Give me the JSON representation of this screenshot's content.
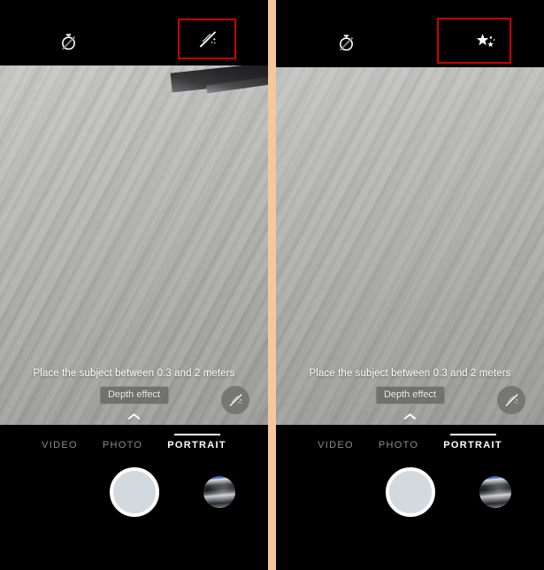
{
  "comparison": {
    "divider_color": "#f6c79d",
    "annotation_color": "#cc0000"
  },
  "panels": [
    {
      "id": "left",
      "topbar": {
        "timer": {
          "icon": "timer-off-icon",
          "label": "Timer off"
        },
        "magic": {
          "icon": "magic-wand-off-icon",
          "label": "Beauty effect off",
          "highlighted": true
        }
      },
      "viewfinder": {
        "hint": "Place the subject between 0.3 and 2 meters",
        "depth_effect_label": "Depth effect",
        "magic_toggle": {
          "icon": "magic-wand-off-icon",
          "label": "Beauty effect off"
        },
        "expand": {
          "icon": "chevron-up-icon",
          "label": "More settings"
        }
      },
      "modes": [
        {
          "label": "VIDEO",
          "active": false
        },
        {
          "label": "PHOTO",
          "active": false
        },
        {
          "label": "PORTRAIT",
          "active": true
        }
      ],
      "shutter": {
        "label": "Shutter",
        "fill_color": "#d2dae0",
        "ring_color": "#ffffff"
      },
      "gallery": {
        "label": "Gallery thumbnail"
      }
    },
    {
      "id": "right",
      "topbar": {
        "timer": {
          "icon": "timer-off-icon",
          "label": "Timer off"
        },
        "magic": {
          "icon": "sparkle-stars-icon",
          "label": "Beauty effect on",
          "highlighted": true
        }
      },
      "viewfinder": {
        "hint": "Place the subject between 0.3 and 2 meters",
        "depth_effect_label": "Depth effect",
        "magic_toggle": {
          "icon": "magic-wand-off-icon",
          "label": "Beauty effect off"
        },
        "expand": {
          "icon": "chevron-up-icon",
          "label": "More settings"
        }
      },
      "modes": [
        {
          "label": "VIDEO",
          "active": false
        },
        {
          "label": "PHOTO",
          "active": false
        },
        {
          "label": "PORTRAIT",
          "active": true
        }
      ],
      "shutter": {
        "label": "Shutter",
        "fill_color": "#d2dae0",
        "ring_color": "#ffffff"
      },
      "gallery": {
        "label": "Gallery thumbnail"
      }
    }
  ]
}
